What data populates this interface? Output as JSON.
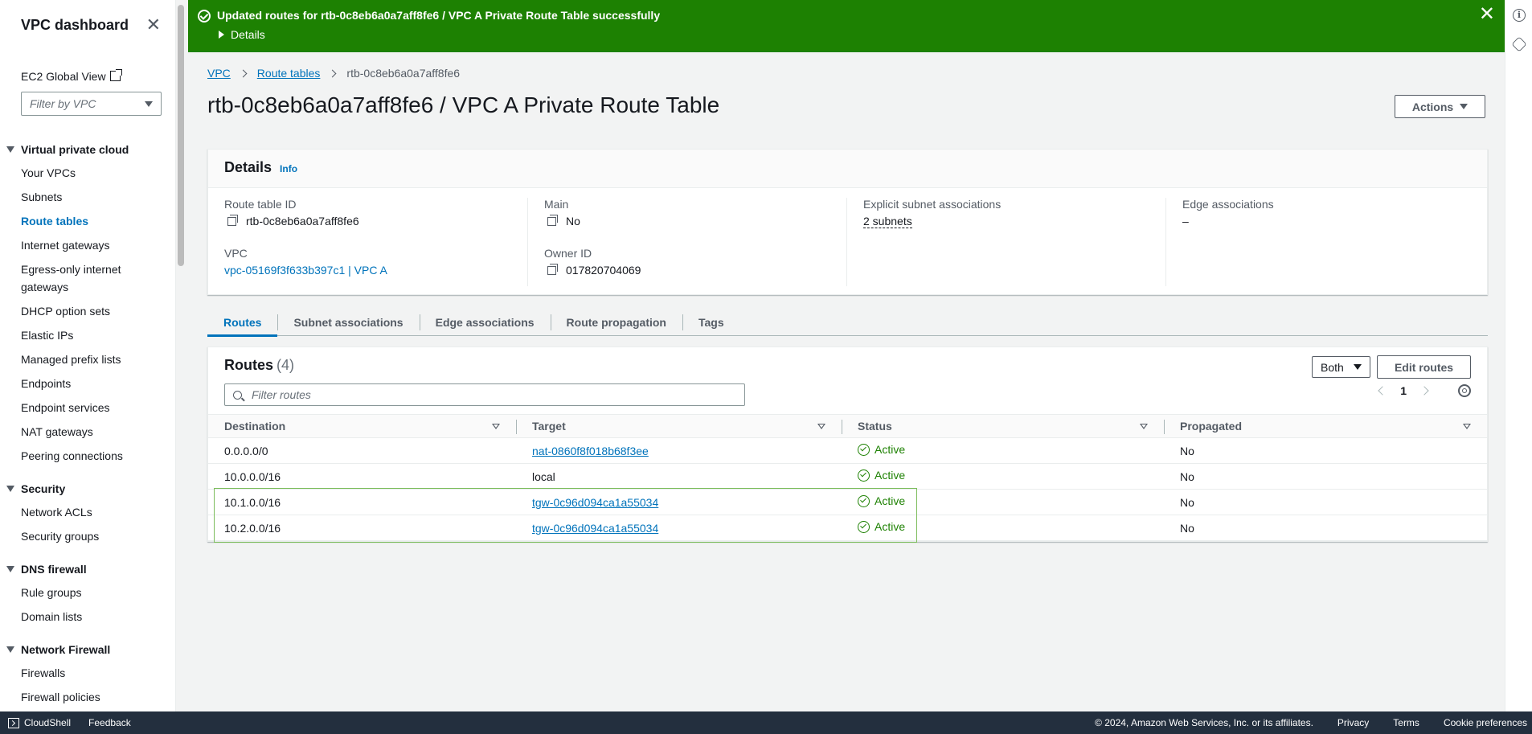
{
  "sidebar": {
    "title": "VPC dashboard",
    "ec2_global_view": "EC2 Global View",
    "filter_placeholder": "Filter by VPC",
    "sections": {
      "vpc": {
        "title": "Virtual private cloud",
        "items": [
          "Your VPCs",
          "Subnets",
          "Route tables",
          "Internet gateways",
          "Egress-only internet gateways",
          "DHCP option sets",
          "Elastic IPs",
          "Managed prefix lists",
          "Endpoints",
          "Endpoint services",
          "NAT gateways",
          "Peering connections"
        ]
      },
      "security": {
        "title": "Security",
        "items": [
          "Network ACLs",
          "Security groups"
        ]
      },
      "dns": {
        "title": "DNS firewall",
        "items": [
          "Rule groups",
          "Domain lists"
        ]
      },
      "nfw": {
        "title": "Network Firewall",
        "items": [
          "Firewalls",
          "Firewall policies"
        ]
      }
    }
  },
  "flash": {
    "message": "Updated routes for rtb-0c8eb6a0a7aff8fe6 / VPC A Private Route Table successfully",
    "details": "Details",
    "color": "#1d8102"
  },
  "breadcrumb": {
    "vpc": "VPC",
    "route_tables": "Route tables",
    "current": "rtb-0c8eb6a0a7aff8fe6"
  },
  "page_title": "rtb-0c8eb6a0a7aff8fe6 / VPC A Private Route Table",
  "actions_label": "Actions",
  "details": {
    "title": "Details",
    "info": "Info",
    "route_table_id_label": "Route table ID",
    "route_table_id": "rtb-0c8eb6a0a7aff8fe6",
    "vpc_label": "VPC",
    "vpc_value": "vpc-05169f3f633b397c1 | VPC A",
    "main_label": "Main",
    "main_value": "No",
    "owner_label": "Owner ID",
    "owner_value": "017820704069",
    "explicit_label": "Explicit subnet associations",
    "explicit_value": "2 subnets",
    "edge_label": "Edge associations",
    "edge_value": "–"
  },
  "tabs": [
    "Routes",
    "Subnet associations",
    "Edge associations",
    "Route propagation",
    "Tags"
  ],
  "routes": {
    "title": "Routes",
    "count": "(4)",
    "filter_placeholder": "Filter routes",
    "both_label": "Both",
    "edit_label": "Edit routes",
    "page": "1",
    "columns": [
      "Destination",
      "Target",
      "Status",
      "Propagated"
    ],
    "rows": [
      {
        "destination": "0.0.0.0/0",
        "target": "nat-0860f8f018b68f3ee",
        "target_link": true,
        "status": "Active",
        "propagated": "No"
      },
      {
        "destination": "10.0.0.0/16",
        "target": "local",
        "target_link": false,
        "status": "Active",
        "propagated": "No"
      },
      {
        "destination": "10.1.0.0/16",
        "target": "tgw-0c96d094ca1a55034",
        "target_link": true,
        "status": "Active",
        "propagated": "No"
      },
      {
        "destination": "10.2.0.0/16",
        "target": "tgw-0c96d094ca1a55034",
        "target_link": true,
        "status": "Active",
        "propagated": "No"
      }
    ]
  },
  "footer": {
    "cloudshell": "CloudShell",
    "feedback": "Feedback",
    "copyright": "© 2024, Amazon Web Services, Inc. or its affiliates.",
    "privacy": "Privacy",
    "terms": "Terms",
    "cookies": "Cookie preferences"
  }
}
